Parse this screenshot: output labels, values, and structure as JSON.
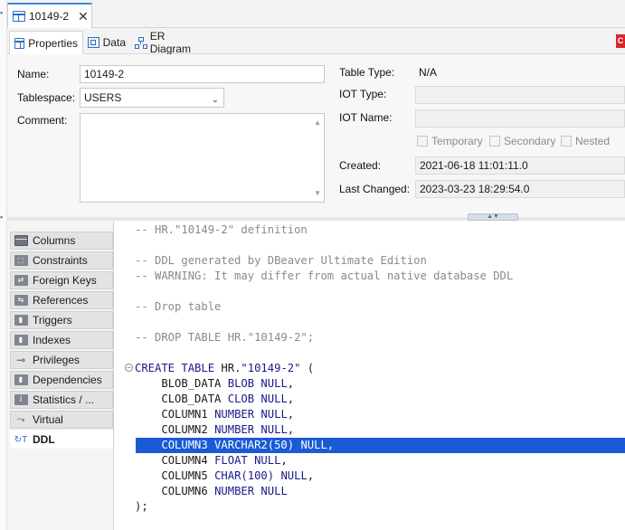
{
  "file_tab": {
    "label": "10149-2"
  },
  "subtabs": [
    {
      "label": "Properties",
      "icon": "table-icon"
    },
    {
      "label": "Data",
      "icon": "data-grid-icon"
    },
    {
      "label": "ER Diagram",
      "icon": "er-diagram-icon"
    }
  ],
  "properties": {
    "name_label": "Name:",
    "name_value": "10149-2",
    "tablespace_label": "Tablespace:",
    "tablespace_value": "USERS",
    "comment_label": "Comment:",
    "table_type_label": "Table Type:",
    "table_type_value": "N/A",
    "iot_type_label": "IOT Type:",
    "iot_name_label": "IOT Name:",
    "temporary_label": "Temporary",
    "secondary_label": "Secondary",
    "nested_label": "Nested",
    "created_label": "Created:",
    "created_value": "2021-06-18 11:01:11.0",
    "last_changed_label": "Last Changed:",
    "last_changed_value": "2023-03-23 18:29:54.0"
  },
  "nav": [
    {
      "label": "Columns",
      "icon": "columns-icon"
    },
    {
      "label": "Constraints",
      "icon": "constraints-icon"
    },
    {
      "label": "Foreign Keys",
      "icon": "foreign-keys-icon"
    },
    {
      "label": "References",
      "icon": "references-icon"
    },
    {
      "label": "Triggers",
      "icon": "triggers-icon"
    },
    {
      "label": "Indexes",
      "icon": "indexes-icon"
    },
    {
      "label": "Privileges",
      "icon": "key-icon"
    },
    {
      "label": "Dependencies",
      "icon": "dependencies-icon"
    },
    {
      "label": "Statistics / ...",
      "icon": "info-icon"
    },
    {
      "label": "Virtual",
      "icon": "virtual-icon"
    },
    {
      "label": "DDL",
      "icon": "ddl-icon",
      "active": true
    }
  ],
  "ddl": {
    "l1": "-- HR.\"10149-2\" definition",
    "l2": "-- DDL generated by DBeaver Ultimate Edition",
    "l3": "-- WARNING: It may differ from actual native database DDL",
    "l4": "-- Drop table",
    "l5": "-- DROP TABLE HR.\"10149-2\";",
    "create_kw": "CREATE TABLE",
    "create_schema": "HR.",
    "create_name": "\"10149-2\"",
    "create_paren": " (",
    "c1_name": "BLOB_DATA ",
    "c1_type": "BLOB",
    "c1_null": " NULL",
    "c1_tail": ",",
    "c2_name": "CLOB_DATA ",
    "c2_type": "CLOB",
    "c2_null": " NULL",
    "c2_tail": ",",
    "c3_name": "COLUMN1 ",
    "c3_type": "NUMBER",
    "c3_null": " NULL",
    "c3_tail": ",",
    "c4_name": "COLUMN2 ",
    "c4_type": "NUMBER",
    "c4_null": " NULL",
    "c4_tail": ",",
    "c5_line": "COLUMN3 VARCHAR2(50) NULL,",
    "c6_name": "COLUMN4 ",
    "c6_type": "FLOAT",
    "c6_null": " NULL",
    "c6_tail": ",",
    "c7_name": "COLUMN5 ",
    "c7_type": "CHAR",
    "c7_num": "(100)",
    "c7_null": " NULL",
    "c7_tail": ",",
    "c8_name": "COLUMN6 ",
    "c8_type": "NUMBER",
    "c8_null": " NULL",
    "end": ");"
  }
}
